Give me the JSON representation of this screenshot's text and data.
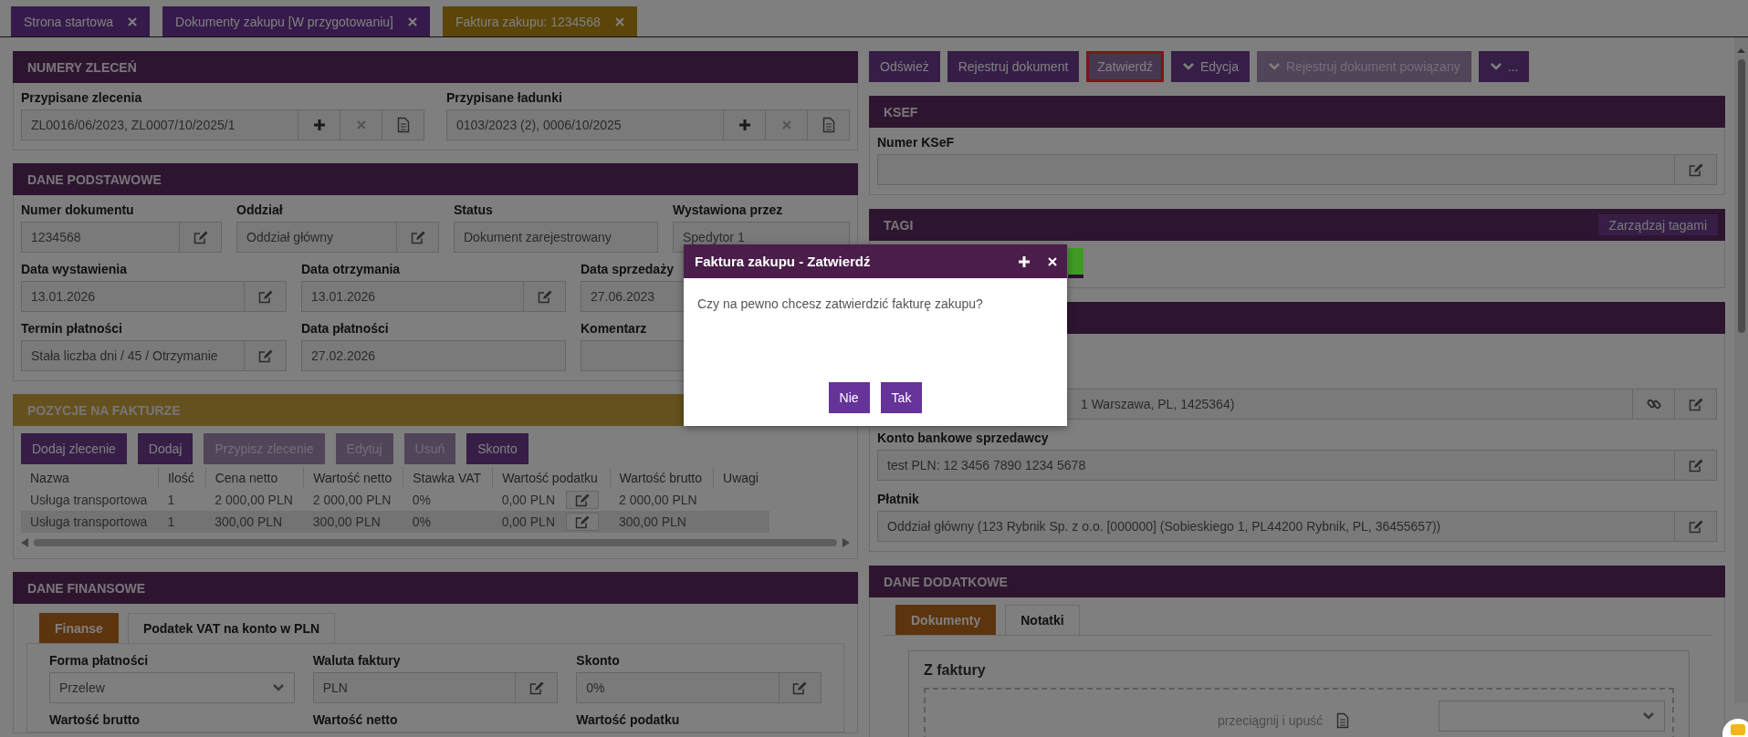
{
  "tabs": [
    {
      "label": "Strona startowa",
      "selected": false
    },
    {
      "label": "Dokumenty zakupu [W przygotowaniu]",
      "selected": false
    },
    {
      "label": "Faktura zakupu: 1234568",
      "selected": true
    }
  ],
  "orders_section": {
    "title": "NUMERY ZLECEŃ",
    "fields": [
      {
        "label": "Przypisane zlecenia",
        "value": "ZL0016/06/2023, ZL0007/10/2025/1"
      },
      {
        "label": "Przypisane ładunki",
        "value": "0103/2023 (2), 0006/10/2025"
      }
    ]
  },
  "basic_section": {
    "title": "DANE PODSTAWOWE",
    "rows": [
      [
        {
          "label": "Numer dokumentu",
          "value": "1234568",
          "editable": true
        },
        {
          "label": "Oddział",
          "value": "Oddział główny",
          "editable": true
        },
        {
          "label": "Status",
          "value": "Dokument zarejestrowany",
          "editable": false
        },
        {
          "label": "Wystawiona przez",
          "value": "Spedytor 1",
          "editable": false
        }
      ],
      [
        {
          "label": "Data wystawienia",
          "value": "13.01.2026",
          "editable": true
        },
        {
          "label": "Data otrzymania",
          "value": "13.01.2026",
          "editable": true
        },
        {
          "label": "Data sprzedaży",
          "value": "27.06.2023",
          "editable": false
        }
      ],
      [
        {
          "label": "Termin płatności",
          "value": "Stała liczba dni / 45 / Otrzymanie",
          "editable": true
        },
        {
          "label": "Data płatności",
          "value": "27.02.2026",
          "editable": false
        },
        {
          "label": "Komentarz",
          "editable": false
        }
      ]
    ]
  },
  "items_section": {
    "title": "POZYCJE NA FAKTURZE",
    "buttons": [
      {
        "label": "Dodaj zlecenie",
        "disabled": false
      },
      {
        "label": "Dodaj",
        "disabled": false
      },
      {
        "label": "Przypisz zlecenie",
        "disabled": true
      },
      {
        "label": "Edytuj",
        "disabled": true
      },
      {
        "label": "Usuń",
        "disabled": true
      },
      {
        "label": "Skonto",
        "disabled": false
      }
    ],
    "columns": [
      "Nazwa",
      "Ilość",
      "Cena netto",
      "Wartość netto",
      "Stawka VAT",
      "Wartość podatku",
      "Wartość brutto",
      "Uwagi"
    ],
    "rows": [
      [
        "Usługa transportowa",
        "1",
        "2 000,00 PLN",
        "2 000,00 PLN",
        "0%",
        "0,00 PLN",
        "2 000,00 PLN"
      ],
      [
        "Usługa transportowa",
        "1",
        "300,00 PLN",
        "300,00 PLN",
        "0%",
        "0,00 PLN",
        "300,00 PLN"
      ]
    ]
  },
  "finance_section": {
    "title": "DANE FINANSOWE",
    "tabs": [
      {
        "label": "Finanse",
        "selected": true
      },
      {
        "label": "Podatek VAT na konto w PLN",
        "selected": false
      }
    ],
    "fields": [
      {
        "label": "Forma płatności",
        "value": "Przelew",
        "kind": "select"
      },
      {
        "label": "Waluta faktury",
        "value": "PLN",
        "kind": "edit"
      },
      {
        "label": "Skonto",
        "value": "0%",
        "kind": "edit"
      }
    ],
    "next_labels": [
      "Wartość brutto",
      "Wartość netto",
      "Wartość podatku"
    ]
  },
  "toolbar": [
    {
      "label": "Odśwież",
      "kind": "plain",
      "disabled": false,
      "highlighted": false
    },
    {
      "label": "Rejestruj dokument",
      "kind": "plain",
      "disabled": false,
      "highlighted": false
    },
    {
      "label": "Zatwierdź",
      "kind": "plain",
      "disabled": false,
      "highlighted": true
    },
    {
      "label": "Edycja",
      "kind": "dropdown",
      "disabled": false,
      "highlighted": false
    },
    {
      "label": "Rejestruj dokument powiązany",
      "kind": "dropdown",
      "disabled": true,
      "highlighted": false
    },
    {
      "label": "...",
      "kind": "dropdown",
      "disabled": false,
      "highlighted": false
    }
  ],
  "ksef_section": {
    "title": "KSEF",
    "field_label": "Numer KSeF"
  },
  "tags_section": {
    "title": "TAGI",
    "manage_button": "Zarządzaj tagami",
    "tags": [
      {
        "color": "#3f9a26"
      }
    ]
  },
  "party_section": {
    "fields": [
      {
        "value": "1 Warszawa, PL, 1425364)",
        "linkable": true
      },
      {
        "label": "Konto bankowe sprzedawcy",
        "value": "test PLN: 12 3456 7890 1234 5678",
        "linkable": false
      },
      {
        "label": "Płatnik",
        "value": "Oddział główny (123 Rybnik Sp. z o.o. [000000] (Sobieskiego 1, PL44200 Rybnik, PL, 36455657))",
        "linkable": false
      }
    ]
  },
  "extra_section": {
    "title": "DANE DODATKOWE",
    "tabs": [
      {
        "label": "Dokumenty",
        "selected": true
      },
      {
        "label": "Notatki",
        "selected": false
      }
    ],
    "box_title": "Z faktury",
    "drop_hint": "przeciągnij i upuść"
  },
  "dialog": {
    "title": "Faktura zakupu - Zatwierdź",
    "message": "Czy na pewno chcesz zatwierdzić fakturę zakupu?",
    "buttons": [
      "Nie",
      "Tak"
    ]
  }
}
